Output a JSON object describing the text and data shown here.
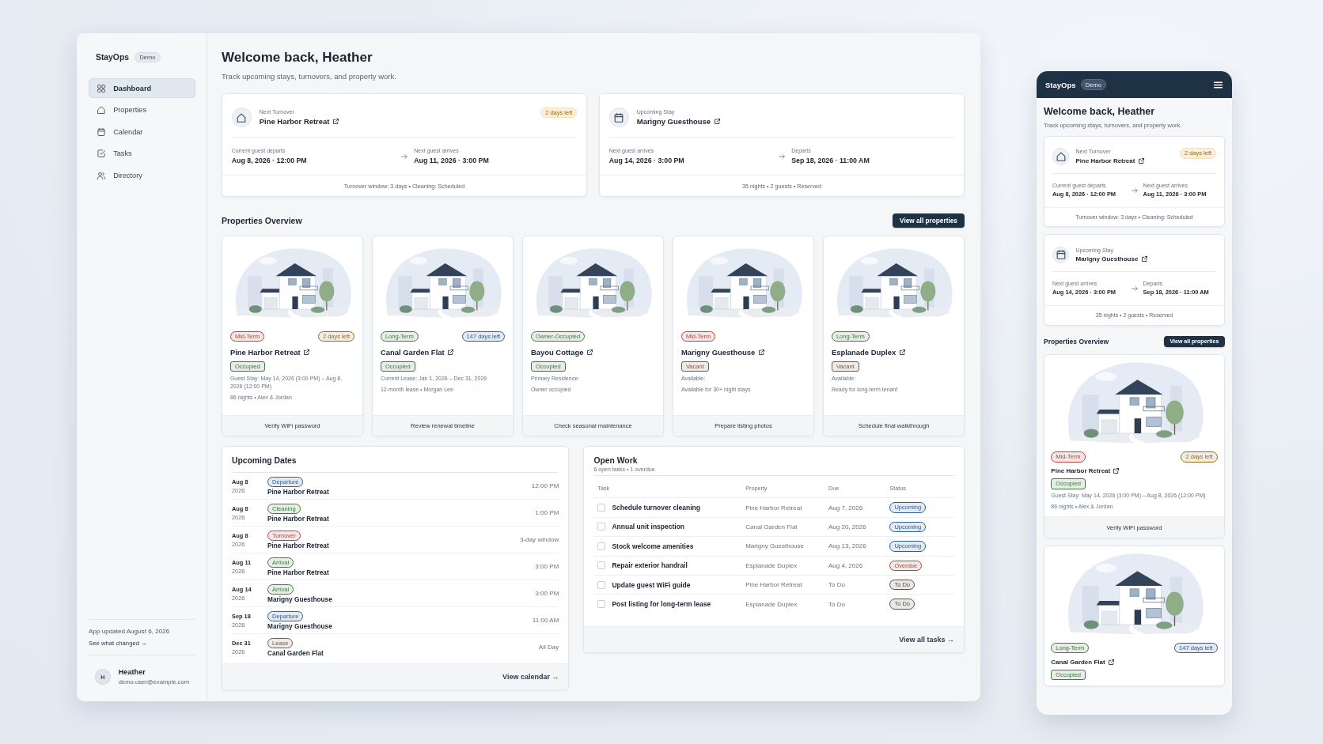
{
  "desktop": {
    "sidebar": {
      "brand": "StayOps",
      "badge": "Demo",
      "items": [
        {
          "label": "Dashboard",
          "selected": true
        },
        {
          "label": "Properties",
          "selected": false
        },
        {
          "label": "Calendar",
          "selected": false
        },
        {
          "label": "Tasks",
          "selected": false
        },
        {
          "label": "Directory",
          "selected": false
        }
      ],
      "update_note": "App updated August 6, 2026",
      "update_link": "See what changed →",
      "user": {
        "initial": "H",
        "name": "Heather",
        "email": "demo.user@example.com"
      }
    },
    "title": "Welcome back, Heather",
    "subtitle": "Track upcoming stays, turnovers, and property work.",
    "stay_cards": [
      {
        "label": "Next Turnover",
        "property": "Pine Harbor Retreat",
        "badge": "2 days left",
        "from_label": "Current guest departs",
        "from_value": "Aug 8, 2026 · 12:00 PM",
        "to_label": "Next guest arrives",
        "to_value": "Aug 11, 2026 · 3:00 PM",
        "footer": "Turnover window: 3 days • Cleaning: Scheduled"
      },
      {
        "label": "Upcoming Stay",
        "property": "Marigny Guesthouse",
        "from_label": "Next guest arrives",
        "from_value": "Aug 14, 2026 · 3:00 PM",
        "to_label": "Departs",
        "to_value": "Sep 18, 2026 · 11:00 AM",
        "footer": "35 nights • 2 guests • Reserved"
      }
    ],
    "properties_title": "Properties Overview",
    "properties_button": "View all properties",
    "properties": [
      {
        "term": {
          "text": "Mid-Term",
          "color": "#b4453a"
        },
        "countdown": {
          "text": "2 days left",
          "color": "#9a6a1c"
        },
        "name": "Pine Harbor Retreat",
        "status": {
          "text": "Occupied",
          "color": "#3f7a3f"
        },
        "details": [
          "Guest Stay: May 14, 2026 (3:00 PM) – Aug 8, 2026 (12:00 PM)",
          "86 nights • Alex & Jordan"
        ],
        "action": "Verify WiFi password"
      },
      {
        "term": {
          "text": "Long-Term",
          "color": "#3f7a3f"
        },
        "countdown": {
          "text": "147 days left",
          "color": "#2f5e9a"
        },
        "name": "Canal Garden Flat",
        "status": {
          "text": "Occupied",
          "color": "#3f7a3f"
        },
        "details": [
          "Current Lease: Jan 1, 2026 – Dec 31, 2026",
          "12-month lease • Morgan Lee"
        ],
        "action": "Review renewal timeline"
      },
      {
        "term": {
          "text": "Owner-Occupied",
          "color": "#3f7a3f"
        },
        "name": "Bayou Cottage",
        "status": {
          "text": "Occupied",
          "color": "#3f7a3f"
        },
        "details": [
          "Primary Residence:",
          "Owner occupied"
        ],
        "action": "Check seasonal maintenance"
      },
      {
        "term": {
          "text": "Mid-Term",
          "color": "#b4453a"
        },
        "name": "Marigny Guesthouse",
        "status": {
          "text": "Vacant",
          "color": "#7a5a44"
        },
        "details": [
          "Available:",
          "Available for 30+ night stays"
        ],
        "action": "Prepare listing photos"
      },
      {
        "term": {
          "text": "Long-Term",
          "color": "#3f7a3f"
        },
        "name": "Esplanade Duplex",
        "status": {
          "text": "Vacant",
          "color": "#7a5a44"
        },
        "details": [
          "Available:",
          "Ready for long-term tenant"
        ],
        "action": "Schedule final walkthrough"
      }
    ],
    "upcoming_dates": {
      "title": "Upcoming Dates",
      "items": [
        {
          "day": "Aug 8",
          "year": "2026",
          "type": {
            "text": "Departure",
            "color": "#2f5e9a"
          },
          "property": "Pine Harbor Retreat",
          "time": "12:00 PM"
        },
        {
          "day": "Aug 8",
          "year": "2026",
          "type": {
            "text": "Cleaning",
            "color": "#3f7a3f"
          },
          "property": "Pine Harbor Retreat",
          "time": "1:00 PM"
        },
        {
          "day": "Aug 8",
          "year": "2026",
          "type": {
            "text": "Turnover",
            "color": "#b4453a"
          },
          "property": "Pine Harbor Retreat",
          "time": "3-day window"
        },
        {
          "day": "Aug 11",
          "year": "2026",
          "type": {
            "text": "Arrival",
            "color": "#3f7a3f"
          },
          "property": "Pine Harbor Retreat",
          "time": "3:00 PM"
        },
        {
          "day": "Aug 14",
          "year": "2026",
          "type": {
            "text": "Arrival",
            "color": "#3f7a3f"
          },
          "property": "Marigny Guesthouse",
          "time": "3:00 PM"
        },
        {
          "day": "Sep 18",
          "year": "2026",
          "type": {
            "text": "Departure",
            "color": "#2f5e9a"
          },
          "property": "Marigny Guesthouse",
          "time": "11:00 AM"
        },
        {
          "day": "Dec 31",
          "year": "2026",
          "type": {
            "text": "Lease",
            "color": "#7a5a44"
          },
          "property": "Canal Garden Flat",
          "time": "All Day"
        }
      ],
      "link": "View calendar →"
    },
    "open_work": {
      "title": "Open Work",
      "summary": "6 open tasks • 1 overdue",
      "columns": [
        "Task",
        "Property",
        "Due",
        "Status"
      ],
      "rows": [
        {
          "task": "Schedule turnover cleaning",
          "checked": false,
          "property": "Pine Harbor Retreat",
          "due": "Aug 7, 2026",
          "status": {
            "text": "Upcoming",
            "color": "#2f5e9a"
          }
        },
        {
          "task": "Annual unit inspection",
          "checked": false,
          "property": "Canal Garden Flat",
          "due": "Aug 20, 2026",
          "status": {
            "text": "Upcoming",
            "color": "#2f5e9a"
          }
        },
        {
          "task": "Stock welcome amenities",
          "checked": false,
          "property": "Marigny Guesthouse",
          "due": "Aug 13, 2026",
          "status": {
            "text": "Upcoming",
            "color": "#2f5e9a"
          }
        },
        {
          "task": "Repair exterior handrail",
          "checked": false,
          "property": "Esplanade Duplex",
          "due": "Aug 4, 2026",
          "status": {
            "text": "Overdue",
            "color": "#b4453a"
          }
        },
        {
          "task": "Update guest WiFi guide",
          "checked": false,
          "property": "Pine Harbor Retreat",
          "due": "To Do",
          "status": {
            "text": "To Do",
            "color": "#5b5148"
          }
        },
        {
          "task": "Post listing for long-term lease",
          "checked": false,
          "property": "Esplanade Duplex",
          "due": "To Do",
          "status": {
            "text": "To Do",
            "color": "#5b5148"
          }
        }
      ],
      "link": "View all tasks →"
    }
  },
  "mobile": {
    "brand": "StayOps",
    "badge": "Demo",
    "title": "Welcome back, Heather",
    "subtitle": "Track upcoming stays, turnovers, and property work.",
    "stay_cards": [
      {
        "label": "Next Turnover",
        "property": "Pine Harbor Retreat",
        "badge": "2 days left",
        "from_label": "Current guest departs",
        "from_value": "Aug 8, 2026 · 12:00 PM",
        "to_label": "Next guest arrives",
        "to_value": "Aug 11, 2026 · 3:00 PM",
        "footer": "Turnover window: 3 days • Cleaning: Scheduled"
      },
      {
        "label": "Upcoming Stay",
        "property": "Marigny Guesthouse",
        "from_label": "Next guest arrives",
        "from_value": "Aug 14, 2026 · 3:00 PM",
        "to_label": "Departs",
        "to_value": "Sep 18, 2026 · 11:00 AM",
        "footer": "35 nights • 2 guests • Reserved"
      }
    ],
    "properties_title": "Properties Overview",
    "properties_button": "View all properties",
    "properties": [
      {
        "term": {
          "text": "Mid-Term",
          "color": "#b4453a"
        },
        "countdown": {
          "text": "2 days left",
          "color": "#9a6a1c"
        },
        "name": "Pine Harbor Retreat",
        "status": {
          "text": "Occupied",
          "color": "#3f7a3f"
        },
        "details": [
          "Guest Stay: May 14, 2026 (3:00 PM) – Aug 8, 2026 (12:00 PM)",
          "86 nights • Alex & Jordan"
        ],
        "action": "Verify WiFi password"
      },
      {
        "term": {
          "text": "Long-Term",
          "color": "#3f7a3f"
        },
        "countdown": {
          "text": "147 days left",
          "color": "#2f5e9a"
        },
        "name": "Canal Garden Flat",
        "status": {
          "text": "Occupied",
          "color": "#3f7a3f"
        }
      }
    ]
  }
}
